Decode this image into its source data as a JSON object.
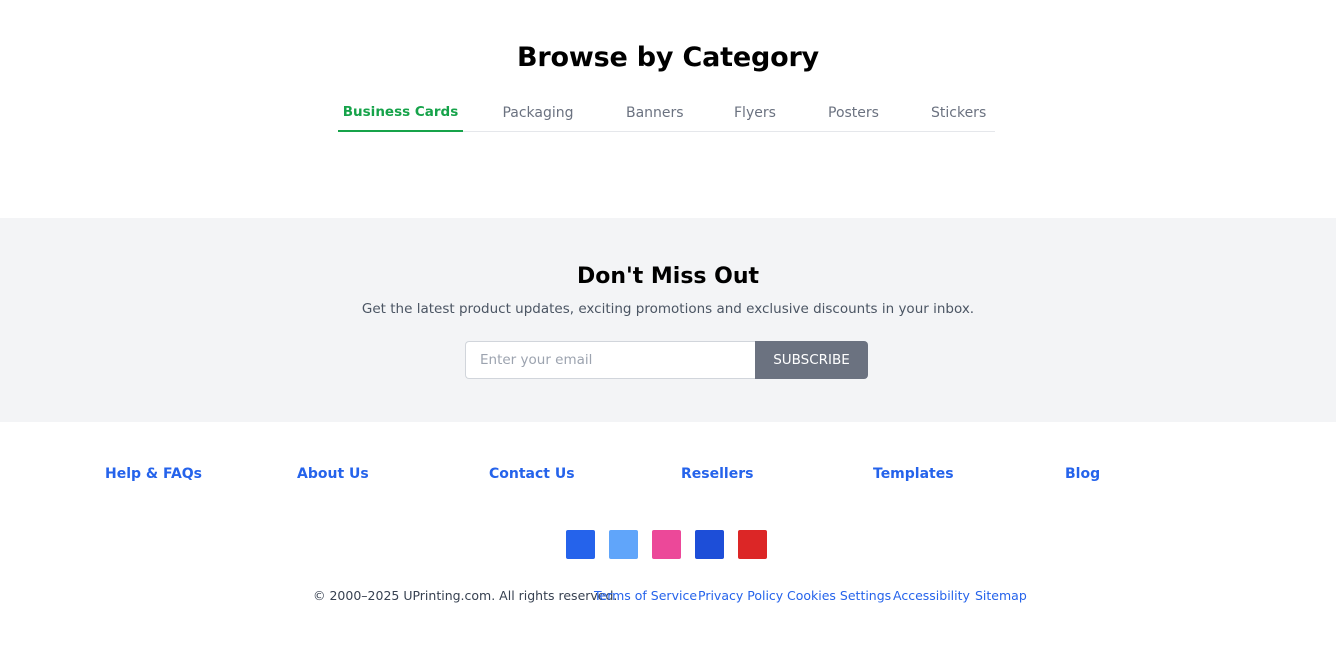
{
  "browse": {
    "title": "Browse by Category",
    "tabs": [
      {
        "label": "Business Cards",
        "active": true
      },
      {
        "label": "Packaging",
        "active": false
      },
      {
        "label": "Banners",
        "active": false
      },
      {
        "label": "Flyers",
        "active": false
      },
      {
        "label": "Posters",
        "active": false
      },
      {
        "label": "Stickers",
        "active": false
      }
    ]
  },
  "newsletter": {
    "title": "Don't Miss Out",
    "description": "Get the latest product updates, exciting promotions and exclusive discounts in your inbox.",
    "email_placeholder": "Enter your email",
    "email_value": "",
    "subscribe_label": "SUBSCRIBE"
  },
  "footer": {
    "links": [
      "Help & FAQs",
      "About Us",
      "Contact Us",
      "Resellers",
      "Templates",
      "Blog"
    ],
    "social": [
      {
        "icon": "facebook-icon",
        "color": "#2563eb"
      },
      {
        "icon": "twitter-icon",
        "color": "#60a5fa"
      },
      {
        "icon": "instagram-icon",
        "color": "#ec4899"
      },
      {
        "icon": "linkedin-icon",
        "color": "#1d4ed8"
      },
      {
        "icon": "youtube-icon",
        "color": "#dc2626"
      }
    ],
    "copyright": "© 2000–2025 UPrinting.com. All rights reserved.",
    "legal": [
      "Terms of Service",
      "Privacy Policy",
      "Cookies Settings",
      "Accessibility",
      "Sitemap"
    ]
  },
  "colors": {
    "accent_green": "#16a34a",
    "link_blue": "#2563eb",
    "button_gray": "#6b7280",
    "band_gray": "#f3f4f6"
  }
}
